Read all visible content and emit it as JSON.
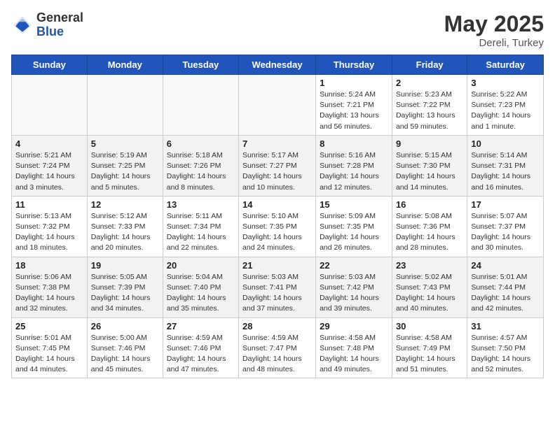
{
  "header": {
    "logo_general": "General",
    "logo_blue": "Blue",
    "month_year": "May 2025",
    "location": "Dereli, Turkey"
  },
  "days_of_week": [
    "Sunday",
    "Monday",
    "Tuesday",
    "Wednesday",
    "Thursday",
    "Friday",
    "Saturday"
  ],
  "weeks": [
    {
      "shaded": false,
      "days": [
        {
          "date": "",
          "info": ""
        },
        {
          "date": "",
          "info": ""
        },
        {
          "date": "",
          "info": ""
        },
        {
          "date": "",
          "info": ""
        },
        {
          "date": "1",
          "info": "Sunrise: 5:24 AM\nSunset: 7:21 PM\nDaylight: 13 hours\nand 56 minutes."
        },
        {
          "date": "2",
          "info": "Sunrise: 5:23 AM\nSunset: 7:22 PM\nDaylight: 13 hours\nand 59 minutes."
        },
        {
          "date": "3",
          "info": "Sunrise: 5:22 AM\nSunset: 7:23 PM\nDaylight: 14 hours\nand 1 minute."
        }
      ]
    },
    {
      "shaded": true,
      "days": [
        {
          "date": "4",
          "info": "Sunrise: 5:21 AM\nSunset: 7:24 PM\nDaylight: 14 hours\nand 3 minutes."
        },
        {
          "date": "5",
          "info": "Sunrise: 5:19 AM\nSunset: 7:25 PM\nDaylight: 14 hours\nand 5 minutes."
        },
        {
          "date": "6",
          "info": "Sunrise: 5:18 AM\nSunset: 7:26 PM\nDaylight: 14 hours\nand 8 minutes."
        },
        {
          "date": "7",
          "info": "Sunrise: 5:17 AM\nSunset: 7:27 PM\nDaylight: 14 hours\nand 10 minutes."
        },
        {
          "date": "8",
          "info": "Sunrise: 5:16 AM\nSunset: 7:28 PM\nDaylight: 14 hours\nand 12 minutes."
        },
        {
          "date": "9",
          "info": "Sunrise: 5:15 AM\nSunset: 7:30 PM\nDaylight: 14 hours\nand 14 minutes."
        },
        {
          "date": "10",
          "info": "Sunrise: 5:14 AM\nSunset: 7:31 PM\nDaylight: 14 hours\nand 16 minutes."
        }
      ]
    },
    {
      "shaded": false,
      "days": [
        {
          "date": "11",
          "info": "Sunrise: 5:13 AM\nSunset: 7:32 PM\nDaylight: 14 hours\nand 18 minutes."
        },
        {
          "date": "12",
          "info": "Sunrise: 5:12 AM\nSunset: 7:33 PM\nDaylight: 14 hours\nand 20 minutes."
        },
        {
          "date": "13",
          "info": "Sunrise: 5:11 AM\nSunset: 7:34 PM\nDaylight: 14 hours\nand 22 minutes."
        },
        {
          "date": "14",
          "info": "Sunrise: 5:10 AM\nSunset: 7:35 PM\nDaylight: 14 hours\nand 24 minutes."
        },
        {
          "date": "15",
          "info": "Sunrise: 5:09 AM\nSunset: 7:35 PM\nDaylight: 14 hours\nand 26 minutes."
        },
        {
          "date": "16",
          "info": "Sunrise: 5:08 AM\nSunset: 7:36 PM\nDaylight: 14 hours\nand 28 minutes."
        },
        {
          "date": "17",
          "info": "Sunrise: 5:07 AM\nSunset: 7:37 PM\nDaylight: 14 hours\nand 30 minutes."
        }
      ]
    },
    {
      "shaded": true,
      "days": [
        {
          "date": "18",
          "info": "Sunrise: 5:06 AM\nSunset: 7:38 PM\nDaylight: 14 hours\nand 32 minutes."
        },
        {
          "date": "19",
          "info": "Sunrise: 5:05 AM\nSunset: 7:39 PM\nDaylight: 14 hours\nand 34 minutes."
        },
        {
          "date": "20",
          "info": "Sunrise: 5:04 AM\nSunset: 7:40 PM\nDaylight: 14 hours\nand 35 minutes."
        },
        {
          "date": "21",
          "info": "Sunrise: 5:03 AM\nSunset: 7:41 PM\nDaylight: 14 hours\nand 37 minutes."
        },
        {
          "date": "22",
          "info": "Sunrise: 5:03 AM\nSunset: 7:42 PM\nDaylight: 14 hours\nand 39 minutes."
        },
        {
          "date": "23",
          "info": "Sunrise: 5:02 AM\nSunset: 7:43 PM\nDaylight: 14 hours\nand 40 minutes."
        },
        {
          "date": "24",
          "info": "Sunrise: 5:01 AM\nSunset: 7:44 PM\nDaylight: 14 hours\nand 42 minutes."
        }
      ]
    },
    {
      "shaded": false,
      "days": [
        {
          "date": "25",
          "info": "Sunrise: 5:01 AM\nSunset: 7:45 PM\nDaylight: 14 hours\nand 44 minutes."
        },
        {
          "date": "26",
          "info": "Sunrise: 5:00 AM\nSunset: 7:46 PM\nDaylight: 14 hours\nand 45 minutes."
        },
        {
          "date": "27",
          "info": "Sunrise: 4:59 AM\nSunset: 7:46 PM\nDaylight: 14 hours\nand 47 minutes."
        },
        {
          "date": "28",
          "info": "Sunrise: 4:59 AM\nSunset: 7:47 PM\nDaylight: 14 hours\nand 48 minutes."
        },
        {
          "date": "29",
          "info": "Sunrise: 4:58 AM\nSunset: 7:48 PM\nDaylight: 14 hours\nand 49 minutes."
        },
        {
          "date": "30",
          "info": "Sunrise: 4:58 AM\nSunset: 7:49 PM\nDaylight: 14 hours\nand 51 minutes."
        },
        {
          "date": "31",
          "info": "Sunrise: 4:57 AM\nSunset: 7:50 PM\nDaylight: 14 hours\nand 52 minutes."
        }
      ]
    }
  ]
}
